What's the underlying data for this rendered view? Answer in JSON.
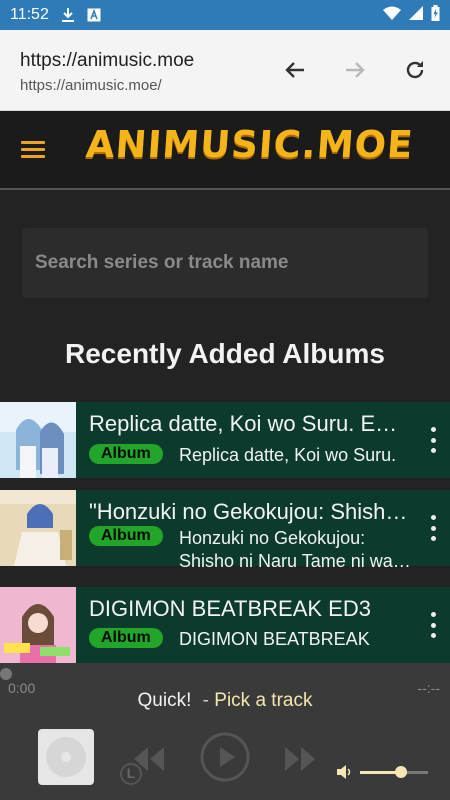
{
  "status_bar": {
    "time": "11:52",
    "icons": [
      "download-icon",
      "a-notification-icon",
      "wifi-icon",
      "signal-icon",
      "battery-icon"
    ]
  },
  "browser": {
    "url_host": "https://animusic.moe",
    "url_full": "https://animusic.moe/",
    "buttons": [
      "back-arrow-icon",
      "forward-arrow-icon",
      "reload-icon"
    ]
  },
  "site": {
    "logo": "ANIMUSIC.MOE",
    "search_placeholder": "Search series or track name",
    "section_title": "Recently Added Albums",
    "badge_label": "Album",
    "colors": {
      "accent": "#f4b41a",
      "row_bg": "#0c3b2e",
      "badge": "#21a629"
    }
  },
  "albums": [
    {
      "title": "Replica datte, Koi wo Suru. Ending",
      "subtitle": "Replica datte, Koi wo Suru."
    },
    {
      "title": "\"Honzuki no Gekokujou: Shisho ni Naru Tame ni wa\"",
      "subtitle": "Honzuki no Gekokujou: Shisho ni Naru Tame ni wa Shudan wo Erandeiraremasen"
    },
    {
      "title": "DIGIMON BEATBREAK ED3",
      "subtitle": "DIGIMON BEATBREAK"
    }
  ],
  "player": {
    "elapsed": "0:00",
    "total": "--:--",
    "title": "Quick!",
    "dash": "-",
    "prompt": "Pick a track",
    "loop_label": "L",
    "progress": 0,
    "volume": 0.6
  }
}
